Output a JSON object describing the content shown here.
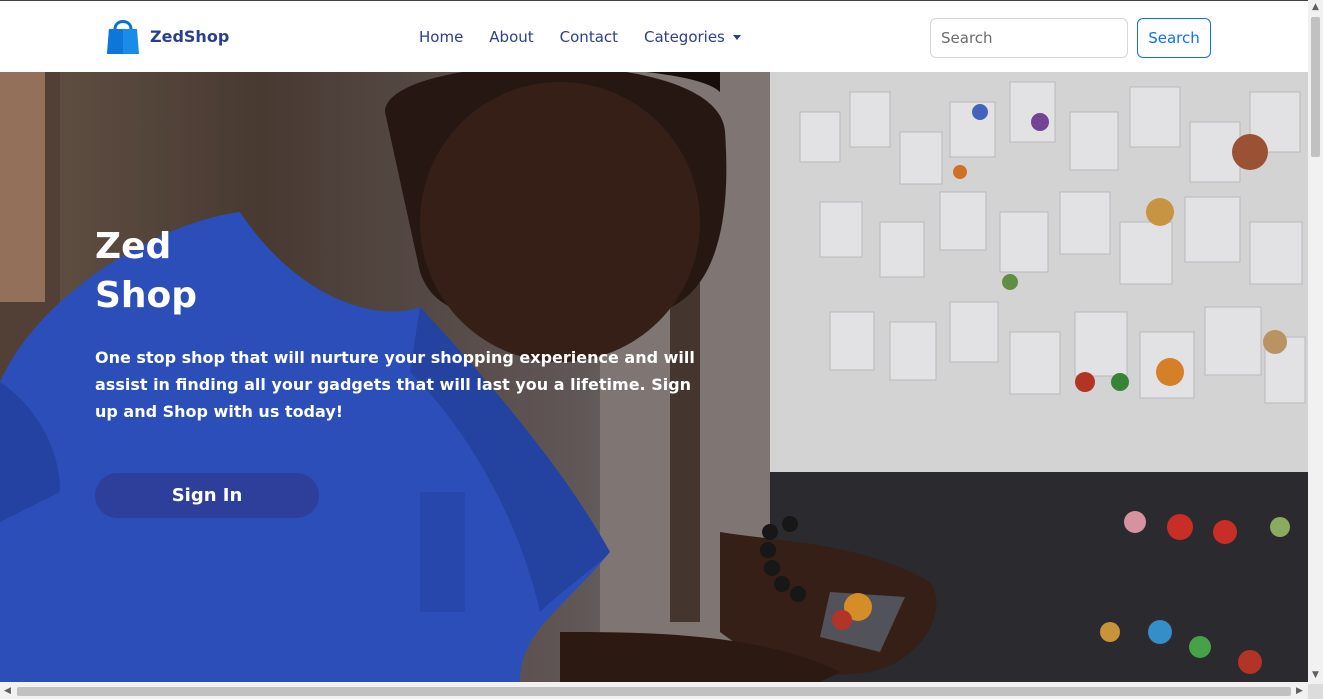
{
  "brand": {
    "name": "ZedShop",
    "icon": "shopping-bag-icon"
  },
  "nav": {
    "home": "Home",
    "about": "About",
    "contact": "Contact",
    "categories": "Categories"
  },
  "search": {
    "placeholder": "Search",
    "value": "",
    "button_label": "Search"
  },
  "hero": {
    "title_line1": "Zed",
    "title_line2": "Shop",
    "description": "One stop shop that will nurture your shopping experience and will assist in finding all your gadgets that will last you a lifetime. Sign up and Shop with us today!",
    "signin_label": "Sign In"
  },
  "scrollbar": {
    "up": "▲",
    "down": "▼",
    "left": "◀",
    "right": "▶"
  },
  "colors": {
    "brand": "#2a3f8f",
    "primary": "#0d6efd",
    "button": "#2d3f9a",
    "hero_shirt": "#2f55c8"
  }
}
